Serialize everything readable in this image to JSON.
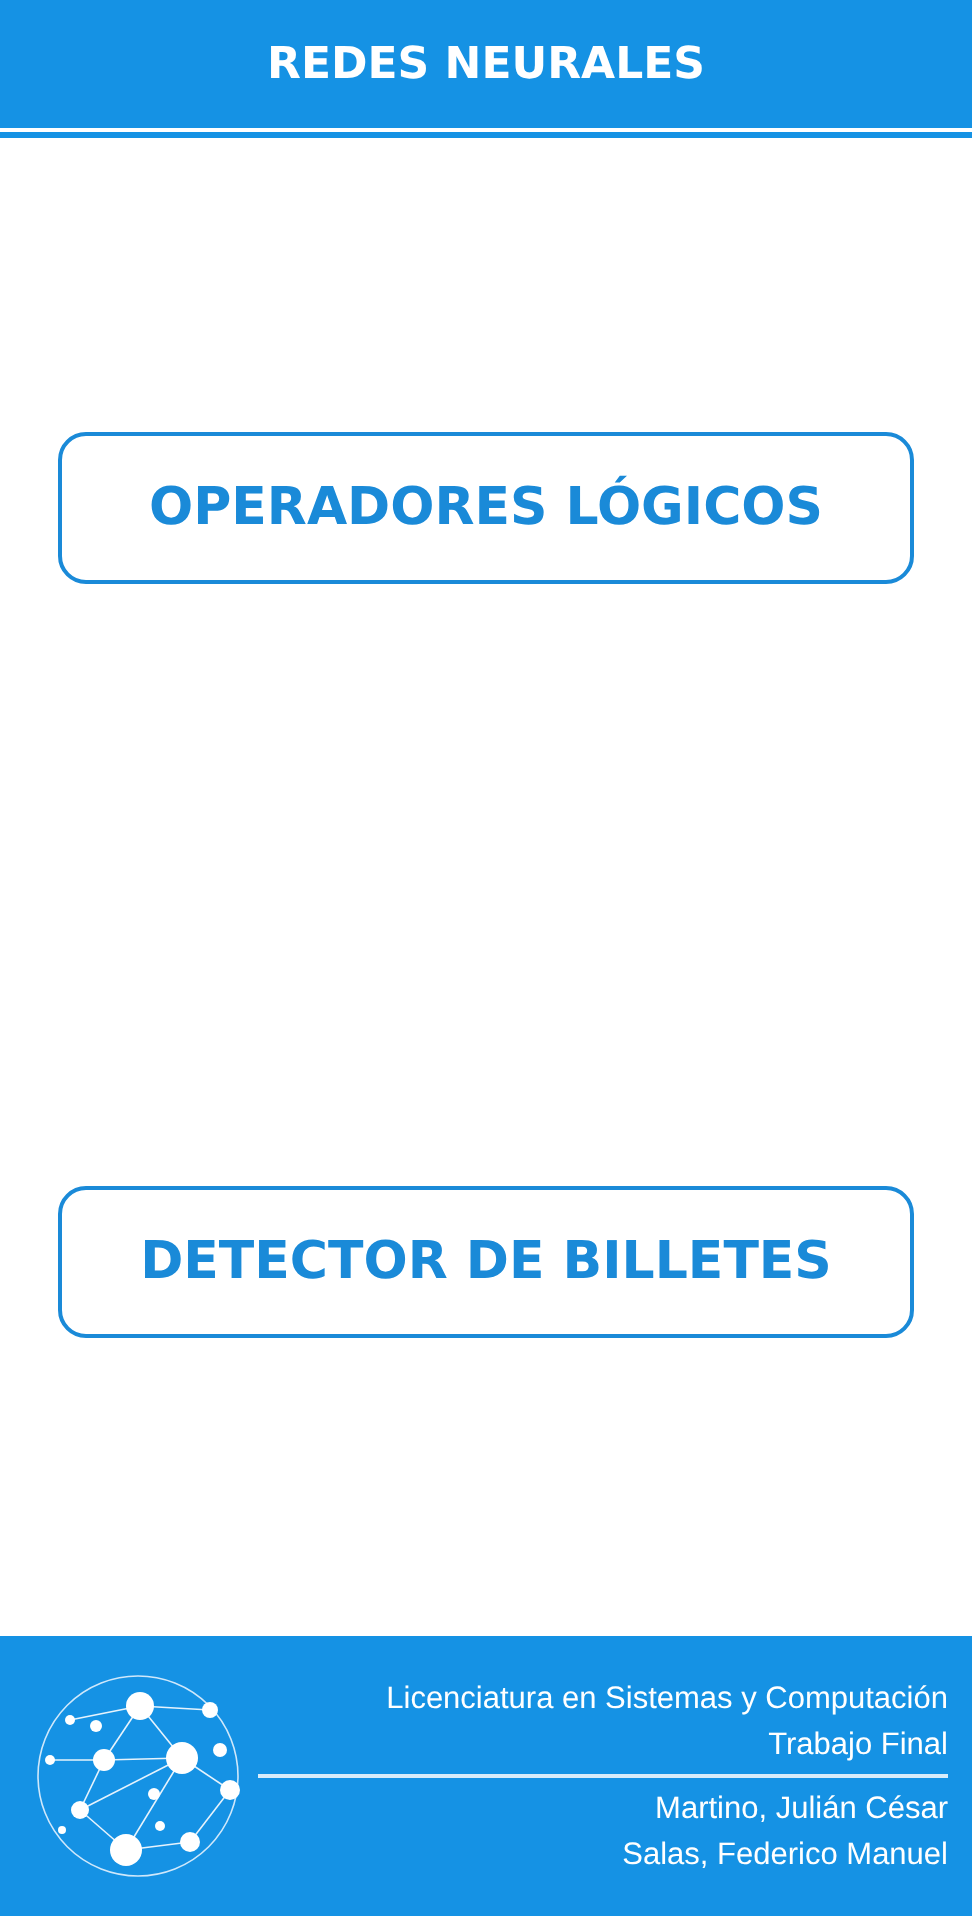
{
  "header": {
    "title": "REDES NEURALES"
  },
  "buttons": [
    {
      "label": "OPERADORES LÓGICOS"
    },
    {
      "label": "DETECTOR DE BILLETES"
    }
  ],
  "footer": {
    "lines_top": [
      "Licenciatura en Sistemas y Computación",
      "Trabajo Final"
    ],
    "lines_bottom": [
      "Martino, Julián César",
      "Salas, Federico Manuel"
    ]
  }
}
